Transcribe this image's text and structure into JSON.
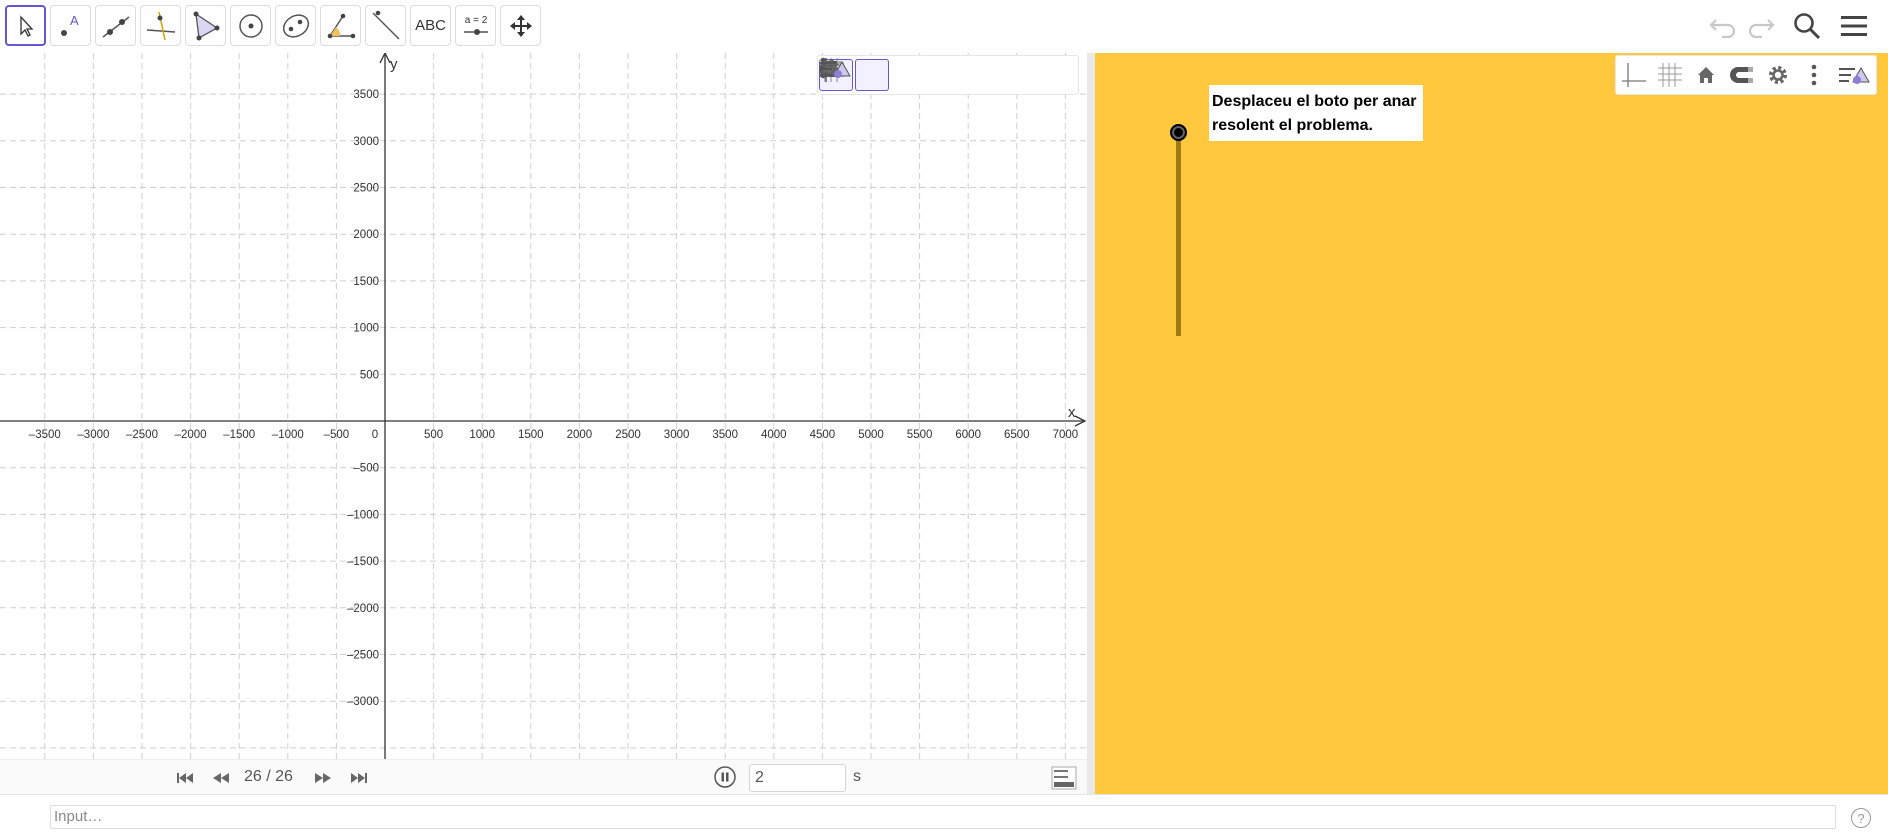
{
  "toolbar": {
    "tools": [
      {
        "name": "move-tool",
        "icon": "arrow-cursor-icon"
      },
      {
        "name": "point-tool",
        "icon": "point-icon",
        "label": "A"
      },
      {
        "name": "line-tool",
        "icon": "line-through-points-icon"
      },
      {
        "name": "perpendicular-line-tool",
        "icon": "perpendicular-line-icon"
      },
      {
        "name": "polygon-tool",
        "icon": "polygon-icon"
      },
      {
        "name": "circle-tool",
        "icon": "circle-center-point-icon"
      },
      {
        "name": "conic-tool",
        "icon": "ellipse-icon"
      },
      {
        "name": "angle-tool",
        "icon": "angle-icon"
      },
      {
        "name": "reflect-tool",
        "icon": "reflect-about-line-icon"
      },
      {
        "name": "text-tool",
        "icon": "text-icon",
        "label": "ABC"
      },
      {
        "name": "slider-tool",
        "icon": "slider-icon",
        "label": "a = 2"
      },
      {
        "name": "move-graphics-view-tool",
        "icon": "move-arrows-icon"
      }
    ],
    "right_icons": [
      "undo-icon",
      "redo-icon",
      "search-icon",
      "hamburger-menu-icon"
    ]
  },
  "graphics1": {
    "style_bar": [
      "axes-icon",
      "grid-icon",
      "home-icon",
      "magnet-icon",
      "gear-icon",
      "more-vertical-icon",
      "view-settings-icon"
    ],
    "x_axis_label": "x",
    "y_axis_label": "y",
    "x_ticks": [
      "–3500",
      "–3000",
      "–2500",
      "–2000",
      "–1500",
      "–1000",
      "–500",
      "0",
      "500",
      "1000",
      "1500",
      "2000",
      "2500",
      "3000",
      "3500",
      "4000",
      "4500",
      "5000",
      "5500",
      "6000",
      "6500",
      "7000"
    ],
    "y_ticks_pos": [
      "3500",
      "3000",
      "2500",
      "2000",
      "1500",
      "1000",
      "500"
    ],
    "y_ticks_neg": [
      "–500",
      "–1000",
      "–1500",
      "–2000",
      "–2500",
      "–3000"
    ]
  },
  "graphics2": {
    "style_bar": [
      "axes-icon",
      "grid-icon",
      "home-icon",
      "magnet-icon",
      "gear-icon",
      "more-vertical-icon",
      "view-settings-icon"
    ],
    "slider_text": "Desplaceu el boto per anar resolent el problema.",
    "colors": {
      "background": "#ffc83d",
      "slider_track": "#a07a15"
    }
  },
  "animation": {
    "frame": "26 / 26",
    "speed": "2",
    "unit": "s"
  },
  "input_bar": {
    "placeholder": "Input…",
    "help": "?"
  }
}
